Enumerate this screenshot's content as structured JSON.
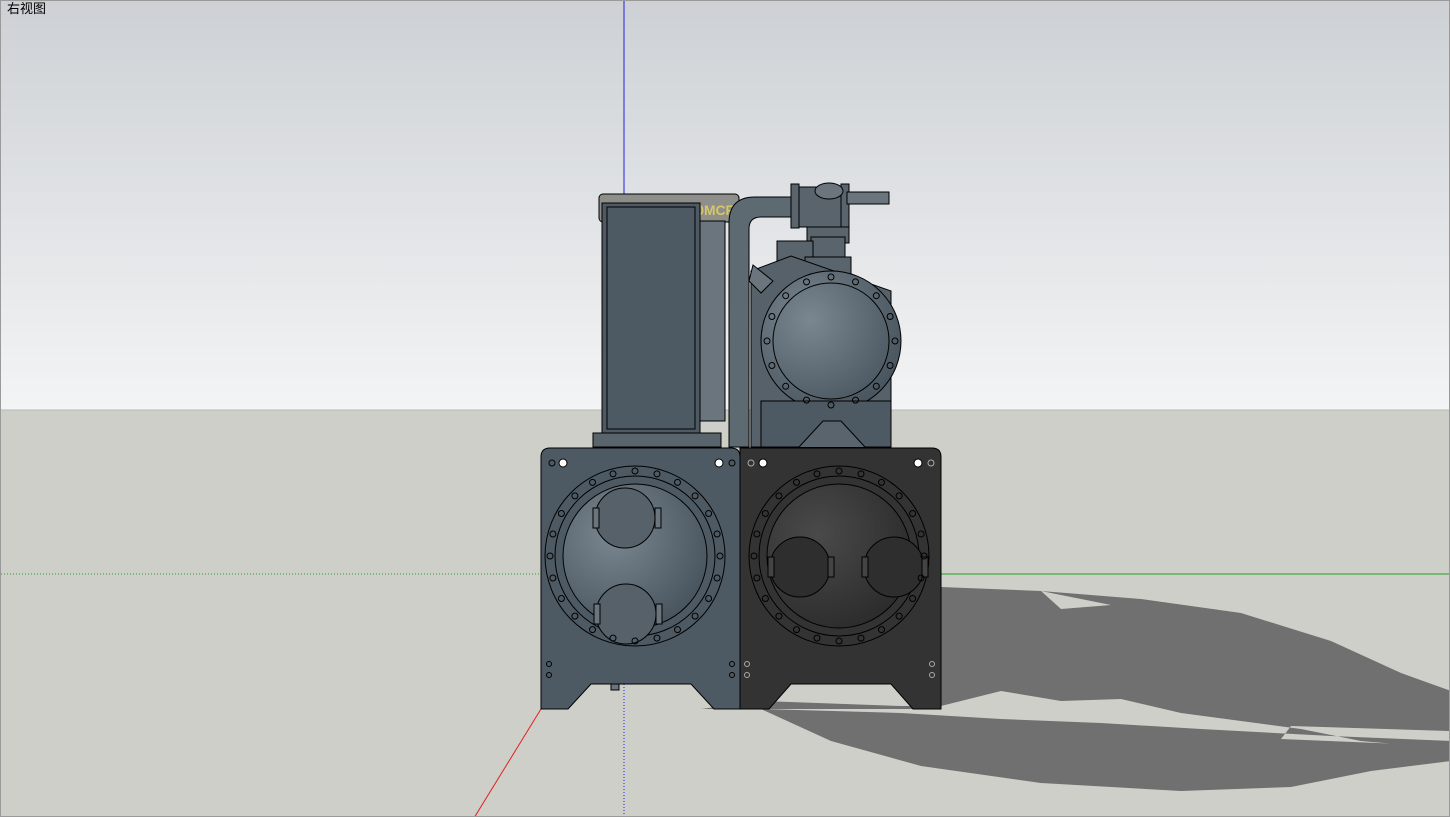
{
  "view": {
    "label": "右视图"
  },
  "model": {
    "nameplate_text": "LCRLGVD4A50MCF"
  },
  "colors": {
    "sky_top": "#cdd1d5",
    "sky_bottom": "#f3f4f5",
    "ground": "#cfcfca",
    "shadow": "#707070",
    "body_blue_grey": "#4e5a63",
    "body_dark": "#333333",
    "outline": "#000000",
    "axis_blue": "#2020e0",
    "axis_red": "#e02020",
    "axis_green": "#20a020"
  }
}
